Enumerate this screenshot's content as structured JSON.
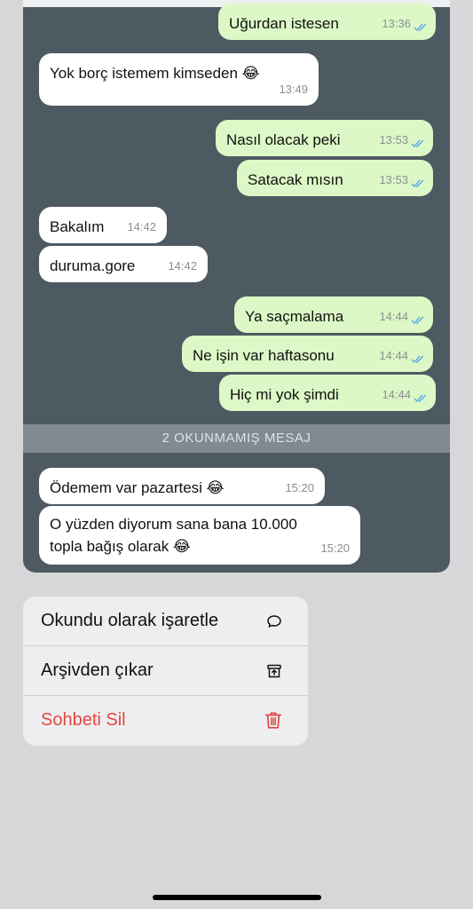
{
  "chat": {
    "messages": [
      {
        "dir": "out",
        "text": "Uğurdan istesen",
        "time": "13:36"
      },
      {
        "dir": "in",
        "text": "Yok borç istemem kimseden 😂",
        "time": "13:49"
      },
      {
        "dir": "out",
        "text": "Nasıl olacak peki",
        "time": "13:53"
      },
      {
        "dir": "out",
        "text": "Satacak mısın",
        "time": "13:53"
      },
      {
        "dir": "in",
        "text": "Bakalım",
        "time": "14:42"
      },
      {
        "dir": "in",
        "text": "duruma.gore",
        "time": "14:42"
      },
      {
        "dir": "out",
        "text": "Ya saçmalama",
        "time": "14:44"
      },
      {
        "dir": "out",
        "text": "Ne işin var haftasonu",
        "time": "14:44"
      },
      {
        "dir": "out",
        "text": "Hiç mi yok şimdi",
        "time": "14:44"
      },
      {
        "dir": "in",
        "text": "Ödemem var pazartesi 😂",
        "time": "15:20"
      },
      {
        "dir": "in",
        "text": "O yüzden diyorum sana bana 10.000 topla bağış olarak 😂",
        "time": "15:20"
      }
    ],
    "unread_divider": "2 OKUNMAMIŞ MESAJ"
  },
  "context_menu": {
    "items": [
      {
        "label": "Okundu olarak işaretle",
        "icon": "chat-bubble-icon"
      },
      {
        "label": "Arşivden çıkar",
        "icon": "unarchive-icon"
      },
      {
        "label": "Sohbeti Sil",
        "icon": "trash-icon",
        "color": "#e2483f"
      }
    ]
  },
  "colors": {
    "chat_background": "#4e5a61",
    "outgoing_bubble": "#dcf8c6",
    "incoming_bubble": "#ffffff",
    "read_checks": "#5ba8e6",
    "destructive": "#e2483f"
  }
}
